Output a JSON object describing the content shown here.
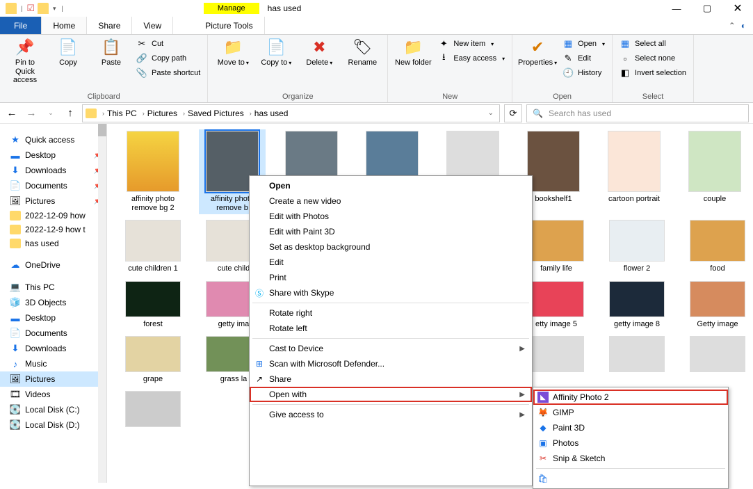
{
  "window": {
    "manage_tab": "Manage",
    "title": "has used"
  },
  "tabs": {
    "file": "File",
    "home": "Home",
    "share": "Share",
    "view": "View",
    "picture_tools": "Picture Tools"
  },
  "ribbon": {
    "clipboard": {
      "label": "Clipboard",
      "pin": "Pin to Quick access",
      "copy": "Copy",
      "paste": "Paste",
      "cut": "Cut",
      "copy_path": "Copy path",
      "paste_shortcut": "Paste shortcut"
    },
    "organize": {
      "label": "Organize",
      "move": "Move to",
      "copy": "Copy to",
      "delete": "Delete",
      "rename": "Rename"
    },
    "new": {
      "label": "New",
      "new_folder": "New folder",
      "new_item": "New item",
      "easy_access": "Easy access"
    },
    "open": {
      "label": "Open",
      "properties": "Properties",
      "open": "Open",
      "edit": "Edit",
      "history": "History"
    },
    "select": {
      "label": "Select",
      "select_all": "Select all",
      "select_none": "Select none",
      "invert": "Invert selection"
    }
  },
  "breadcrumb": {
    "root": "This PC",
    "p1": "Pictures",
    "p2": "Saved Pictures",
    "p3": "has used"
  },
  "search": {
    "placeholder": "Search has used"
  },
  "nav": {
    "quick_access": "Quick access",
    "desktop": "Desktop",
    "downloads": "Downloads",
    "documents": "Documents",
    "pictures": "Pictures",
    "f1": "2022-12-09 how",
    "f2": "2022-12-9 how t",
    "f3": "has used",
    "onedrive": "OneDrive",
    "thispc": "This PC",
    "objects3d": "3D Objects",
    "desktop2": "Desktop",
    "documents2": "Documents",
    "downloads2": "Downloads",
    "music": "Music",
    "pictures2": "Pictures",
    "videos": "Videos",
    "diskc": "Local Disk (C:)",
    "diskd": "Local Disk (D:)"
  },
  "files": [
    {
      "name": "affinity photo remove bg 2",
      "sel": false,
      "bg": "bg1"
    },
    {
      "name": "affinity photo remove b",
      "sel": true,
      "bg": "bg2"
    },
    {
      "name": "",
      "sel": false,
      "bg": "bg3"
    },
    {
      "name": "",
      "sel": false,
      "bg": "bg4"
    },
    {
      "name": "",
      "sel": false,
      "bg": "bg20"
    },
    {
      "name": "bookshelf1",
      "sel": false,
      "bg": "bg5"
    },
    {
      "name": "cartoon portrait",
      "sel": false,
      "bg": "bg6"
    },
    {
      "name": "couple",
      "sel": false,
      "bg": "bg7"
    }
  ],
  "files2": [
    {
      "name": "cute children 1",
      "bg": "bg8"
    },
    {
      "name": "cute child",
      "bg": "bg8"
    },
    {
      "name": "",
      "bg": "bg20"
    },
    {
      "name": "",
      "bg": "bg20"
    },
    {
      "name": "",
      "bg": "bg20"
    },
    {
      "name": "family life",
      "bg": "bg12"
    },
    {
      "name": "flower 2",
      "bg": "bg19"
    },
    {
      "name": "food",
      "bg": "bg12"
    }
  ],
  "files3": [
    {
      "name": "forest",
      "bg": "bg10"
    },
    {
      "name": "getty ima",
      "bg": "bg11"
    },
    {
      "name": "",
      "bg": "bg20"
    },
    {
      "name": "",
      "bg": "bg20"
    },
    {
      "name": "",
      "bg": "bg20"
    },
    {
      "name": "etty image 5",
      "bg": "bg13"
    },
    {
      "name": "getty image 8",
      "bg": "bg14"
    },
    {
      "name": "Getty image",
      "bg": "bg15"
    }
  ],
  "files4": [
    {
      "name": "grape",
      "bg": "bg17"
    },
    {
      "name": "grass la",
      "bg": "bg16"
    },
    {
      "name": "",
      "bg": "bg20"
    },
    {
      "name": "",
      "bg": "bg20"
    },
    {
      "name": "",
      "bg": "bg20"
    },
    {
      "name": "",
      "bg": "bg20"
    },
    {
      "name": "",
      "bg": "bg20"
    },
    {
      "name": "",
      "bg": "bg20"
    }
  ],
  "files5": [
    {
      "name": "",
      "bg": "bg18"
    }
  ],
  "context": {
    "open": "Open",
    "new_video": "Create a new video",
    "edit_photos": "Edit with Photos",
    "edit_paint3d": "Edit with Paint 3D",
    "set_bg": "Set as desktop background",
    "edit": "Edit",
    "print": "Print",
    "share_skype": "Share with Skype",
    "rotate_right": "Rotate right",
    "rotate_left": "Rotate left",
    "cast": "Cast to Device",
    "scan": "Scan with Microsoft Defender...",
    "share": "Share",
    "open_with": "Open with",
    "give_access": "Give access to"
  },
  "submenu": {
    "affinity": "Affinity Photo 2",
    "gimp": "GIMP",
    "paint3d": "Paint 3D",
    "photos": "Photos",
    "snip": "Snip & Sketch"
  }
}
